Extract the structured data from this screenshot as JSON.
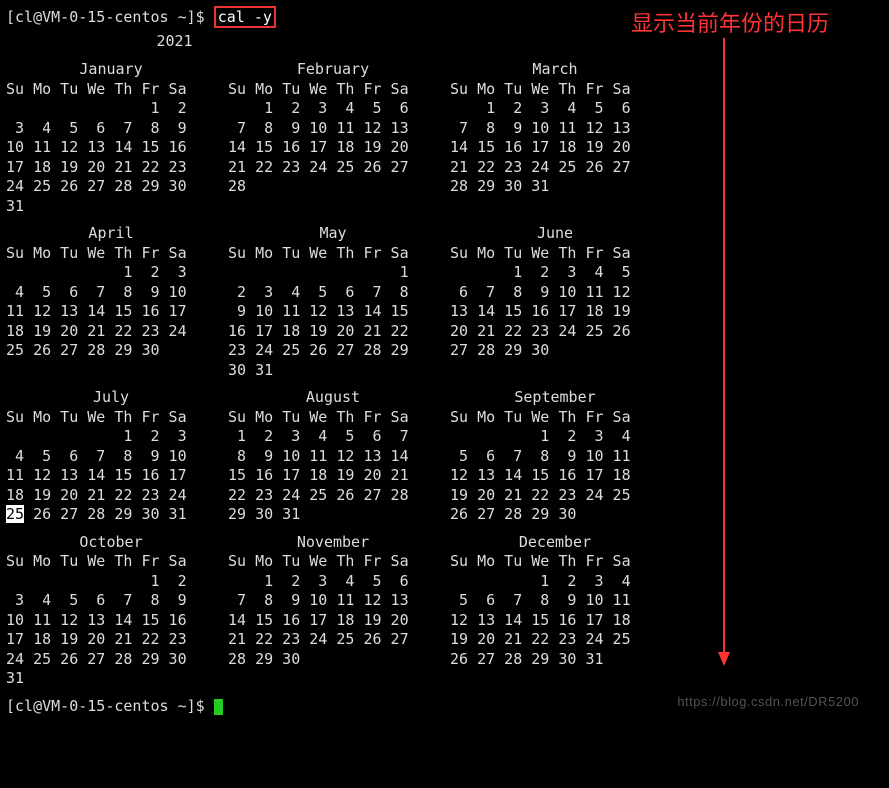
{
  "prompt": {
    "user_host": "[cl@VM-0-15-centos ~]$ ",
    "command": "cal -y",
    "prompt2": "[cl@VM-0-15-centos ~]$ "
  },
  "annotation": "显示当前年份的日历",
  "year": "2021",
  "day_header": "Su Mo Tu We Th Fr Sa",
  "today": {
    "month": "July",
    "day": "25"
  },
  "watermark": "https://blog.csdn.net/DR5200",
  "months": [
    {
      "name": "January",
      "rows": [
        "                1  2",
        " 3  4  5  6  7  8  9",
        "10 11 12 13 14 15 16",
        "17 18 19 20 21 22 23",
        "24 25 26 27 28 29 30",
        "31"
      ]
    },
    {
      "name": "February",
      "rows": [
        "    1  2  3  4  5  6",
        " 7  8  9 10 11 12 13",
        "14 15 16 17 18 19 20",
        "21 22 23 24 25 26 27",
        "28"
      ]
    },
    {
      "name": "March",
      "rows": [
        "    1  2  3  4  5  6",
        " 7  8  9 10 11 12 13",
        "14 15 16 17 18 19 20",
        "21 22 23 24 25 26 27",
        "28 29 30 31"
      ]
    },
    {
      "name": "April",
      "rows": [
        "             1  2  3",
        " 4  5  6  7  8  9 10",
        "11 12 13 14 15 16 17",
        "18 19 20 21 22 23 24",
        "25 26 27 28 29 30"
      ]
    },
    {
      "name": "May",
      "rows": [
        "                   1",
        " 2  3  4  5  6  7  8",
        " 9 10 11 12 13 14 15",
        "16 17 18 19 20 21 22",
        "23 24 25 26 27 28 29",
        "30 31"
      ]
    },
    {
      "name": "June",
      "rows": [
        "       1  2  3  4  5",
        " 6  7  8  9 10 11 12",
        "13 14 15 16 17 18 19",
        "20 21 22 23 24 25 26",
        "27 28 29 30"
      ]
    },
    {
      "name": "July",
      "rows": [
        "             1  2  3",
        " 4  5  6  7  8  9 10",
        "11 12 13 14 15 16 17",
        "18 19 20 21 22 23 24",
        "25 26 27 28 29 30 31"
      ]
    },
    {
      "name": "August",
      "rows": [
        " 1  2  3  4  5  6  7",
        " 8  9 10 11 12 13 14",
        "15 16 17 18 19 20 21",
        "22 23 24 25 26 27 28",
        "29 30 31"
      ]
    },
    {
      "name": "September",
      "rows": [
        "          1  2  3  4",
        " 5  6  7  8  9 10 11",
        "12 13 14 15 16 17 18",
        "19 20 21 22 23 24 25",
        "26 27 28 29 30"
      ]
    },
    {
      "name": "October",
      "rows": [
        "                1  2",
        " 3  4  5  6  7  8  9",
        "10 11 12 13 14 15 16",
        "17 18 19 20 21 22 23",
        "24 25 26 27 28 29 30",
        "31"
      ]
    },
    {
      "name": "November",
      "rows": [
        "    1  2  3  4  5  6",
        " 7  8  9 10 11 12 13",
        "14 15 16 17 18 19 20",
        "21 22 23 24 25 26 27",
        "28 29 30"
      ]
    },
    {
      "name": "December",
      "rows": [
        "          1  2  3  4",
        " 5  6  7  8  9 10 11",
        "12 13 14 15 16 17 18",
        "19 20 21 22 23 24 25",
        "26 27 28 29 30 31"
      ]
    }
  ]
}
